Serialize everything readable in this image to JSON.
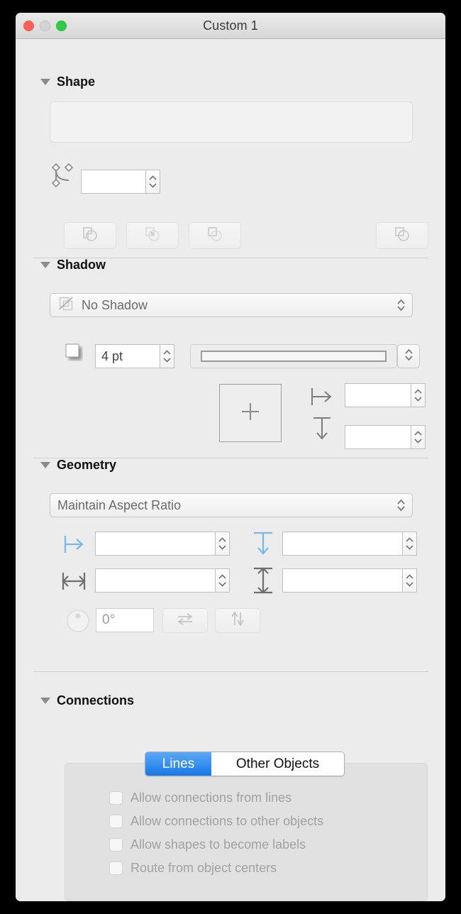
{
  "window": {
    "title": "Custom 1",
    "controls": [
      {
        "name": "close",
        "icon": "close-button",
        "color": "#fc6058"
      },
      {
        "name": "minimize",
        "icon": "minimize-button",
        "color": "#d4d4d4"
      },
      {
        "name": "zoom",
        "icon": "maximize-button",
        "color": "#2ecc40"
      }
    ]
  },
  "shape": {
    "title": "Shape",
    "preview_placeholder": "",
    "corner_radius": {
      "icon": "bezier-corner-icon",
      "value": "",
      "placeholder": ""
    },
    "buttons": [
      {
        "name": "shape-union-button",
        "icon": "union-icon"
      },
      {
        "name": "shape-intersect-button",
        "icon": "intersect-icon"
      },
      {
        "name": "shape-subtract-button",
        "icon": "subtract-icon"
      },
      {
        "name": "shape-combine-button",
        "icon": "combine-icon"
      }
    ]
  },
  "shadow": {
    "title": "Shadow",
    "type": {
      "icon": "no-shadow-icon",
      "value": "No Shadow"
    },
    "blur": {
      "icon": "shadow-swatch-icon",
      "value": "4 pt"
    },
    "spread": {
      "icon": "line-width-preview-icon",
      "value": ""
    },
    "offset_pad": {
      "icon": "crosshair-icon"
    },
    "offset_x": {
      "icon": "offset-horizontal-icon",
      "value": ""
    },
    "offset_y": {
      "icon": "offset-vertical-icon",
      "value": ""
    }
  },
  "geometry": {
    "title": "Geometry",
    "aspect": {
      "value": "Maintain Aspect Ratio"
    },
    "position_x": {
      "icon": "position-x-icon",
      "value": ""
    },
    "position_y": {
      "icon": "position-y-icon",
      "value": ""
    },
    "width": {
      "icon": "width-icon",
      "value": ""
    },
    "height": {
      "icon": "height-icon",
      "value": ""
    },
    "rotation": {
      "icon": "rotation-knob-icon",
      "value": "0°"
    },
    "flip_horizontal": {
      "icon": "flip-horizontal-icon"
    },
    "flip_vertical": {
      "icon": "flip-vertical-icon"
    }
  },
  "connections": {
    "title": "Connections",
    "tabs": [
      {
        "label": "Lines",
        "selected": true
      },
      {
        "label": "Other Objects",
        "selected": false
      }
    ],
    "options": [
      {
        "label": "Allow connections from lines",
        "checked": false,
        "enabled": false
      },
      {
        "label": "Allow connections to other objects",
        "checked": false,
        "enabled": false
      },
      {
        "label": "Allow shapes to become labels",
        "checked": false,
        "enabled": false
      },
      {
        "label": "Route from object centers",
        "checked": false,
        "enabled": false
      }
    ]
  },
  "colors": {
    "window_bg": "#ececec",
    "accent": "#1878e8",
    "disabled_text": "#a2a2a2",
    "blue_icon": "#7bb6e8"
  }
}
